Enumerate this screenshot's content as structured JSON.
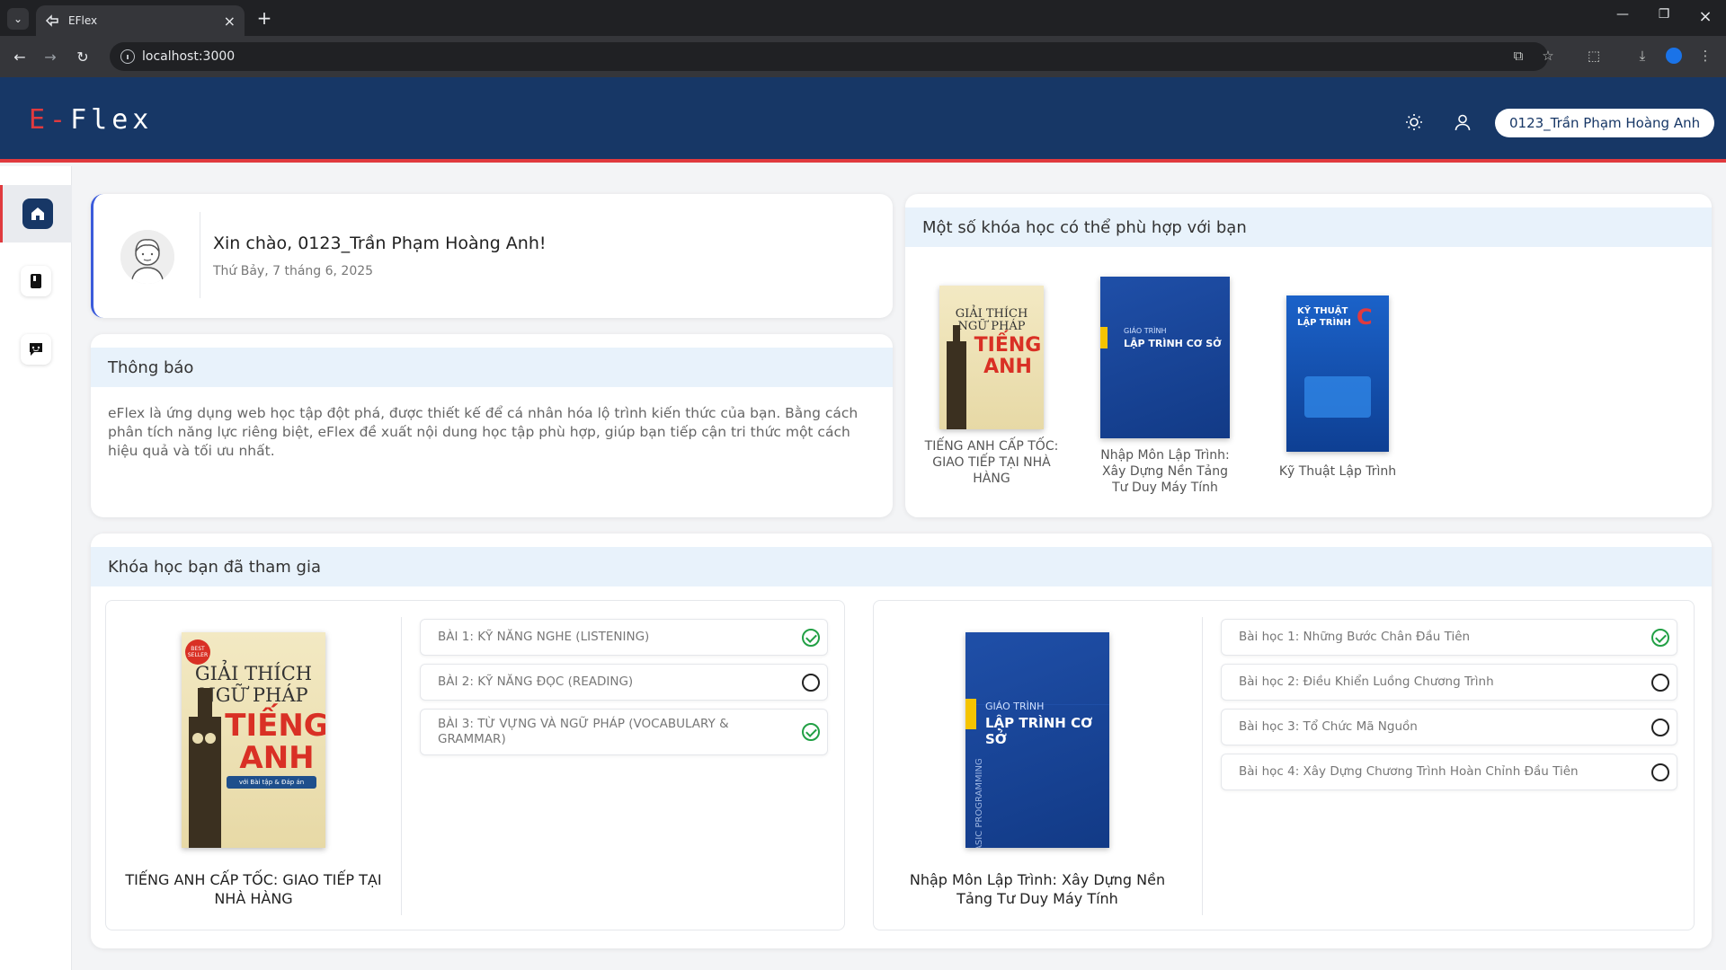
{
  "browser": {
    "tab_title": "EFlex",
    "url": "localhost:3000"
  },
  "app": {
    "logo_e": "E-",
    "logo_rest": "Flex",
    "user_name": "0123_Trần Phạm Hoàng Anh"
  },
  "greeting": {
    "title": "Xin chào, 0123_Trần Phạm Hoàng Anh!",
    "date": "Thứ Bảy, 7 tháng 6, 2025"
  },
  "notice": {
    "heading": "Thông báo",
    "body": "eFlex là ứng dụng web học tập đột phá, được thiết kế để cá nhân hóa lộ trình kiến thức của bạn. Bằng cách phân tích năng lực riêng biệt, eFlex đề xuất nội dung học tập phù hợp, giúp bạn tiếp cận tri thức một cách hiệu quả và tối ưu nhất."
  },
  "recommendations": {
    "heading": "Một số khóa học có thể phù hợp với bạn",
    "items": [
      {
        "title": "TIẾNG ANH CẤP TỐC: GIAO TIẾP TẠI NHÀ HÀNG"
      },
      {
        "title": "Nhập Môn Lập Trình: Xây Dựng Nền Tảng Tư Duy Máy Tính"
      },
      {
        "title": "Kỹ Thuật Lập Trình"
      }
    ]
  },
  "covers": {
    "eng_line1": "GIẢI THÍCH",
    "eng_line2": "NGỮ PHÁP",
    "eng_line3": "TIẾNG",
    "eng_line4": "ANH",
    "eng_badge": "BEST SELLER",
    "eng_sub": "với Bài tập & Đáp án",
    "prog_label": "GIÁO TRÌNH",
    "prog_title": "LẬP TRÌNH CƠ SỞ",
    "prog_side": "BASIC PROGRAMMING",
    "kt_title1": "KỸ THUẬT",
    "kt_title2": "LẬP TRÌNH",
    "kt_c": "C"
  },
  "joined": {
    "heading": "Khóa học bạn đã tham gia",
    "courses": [
      {
        "name": "TIẾNG ANH CẤP TỐC: GIAO TIẾP TẠI NHÀ HÀNG",
        "lessons": [
          {
            "title": "BÀI 1: KỸ NĂNG NGHE (LISTENING)",
            "done": true
          },
          {
            "title": "BÀI 2: KỸ NĂNG ĐỌC (READING)",
            "done": false
          },
          {
            "title": "BÀI 3: TỪ VỰNG VÀ NGỮ PHÁP (VOCABULARY & GRAMMAR)",
            "done": true
          }
        ]
      },
      {
        "name": "Nhập Môn Lập Trình: Xây Dựng Nền Tảng Tư Duy Máy Tính",
        "lessons": [
          {
            "title": "Bài học 1: Những Bước Chân Đầu Tiên",
            "done": true
          },
          {
            "title": "Bài học 2: Điều Khiển Luồng Chương Trình",
            "done": false
          },
          {
            "title": "Bài học 3: Tổ Chức Mã Nguồn",
            "done": false
          },
          {
            "title": "Bài học 4: Xây Dựng Chương Trình Hoàn Chỉnh Đầu Tiên",
            "done": false
          }
        ]
      }
    ]
  },
  "icons": {
    "sidebar": [
      "home-icon",
      "book-icon",
      "chat-icon"
    ],
    "header": [
      "sun-icon",
      "user-icon"
    ]
  },
  "colors": {
    "header_bg": "#173766",
    "accent_red": "#e03a3e",
    "done_green": "#22a045"
  }
}
